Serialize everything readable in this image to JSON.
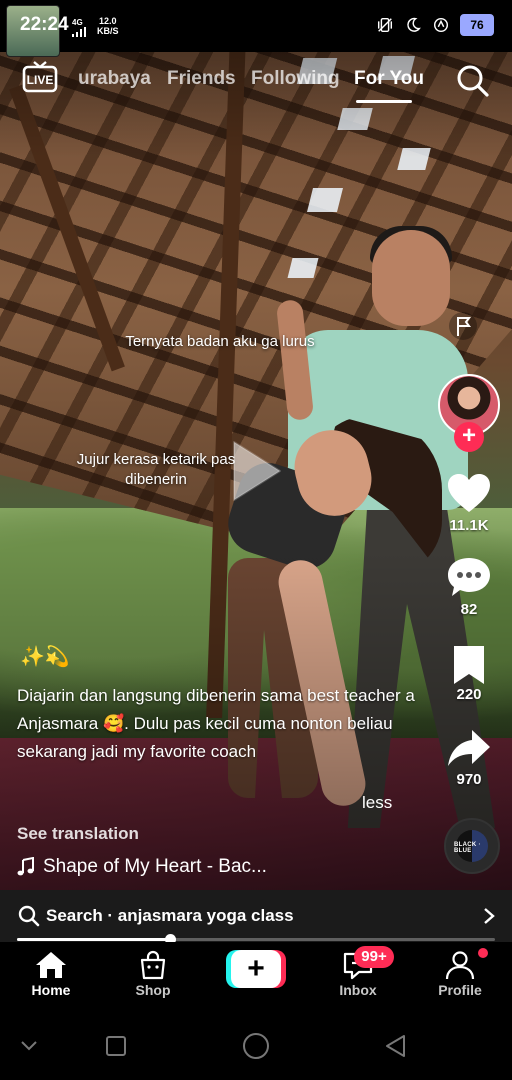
{
  "status_bar": {
    "time": "22:24",
    "network": "4G",
    "speed_value": "12.0",
    "speed_unit": "KB/S",
    "battery": "76"
  },
  "top_nav": {
    "live_label": "LIVE",
    "tabs": [
      "urabaya",
      "Friends",
      "Following",
      "For You"
    ],
    "active_tab": "For You"
  },
  "video": {
    "caption_overlay_1": "Ternyata badan aku ga lurus",
    "caption_overlay_2_line1": "Jujur kerasa ketarik pas",
    "caption_overlay_2_line2": "dibenerin"
  },
  "actions": {
    "likes": "11.1K",
    "comments": "82",
    "saves": "220",
    "shares": "970"
  },
  "post": {
    "emojis": "✨💫",
    "description_part1": "Diajarin dan langsung dibenerin sama best teacher a Anjasmara ",
    "description_emoji": "🥰",
    "description_part2": ". Dulu pas kecil cuma nonton beliau sekarang jadi my favorite coach",
    "less_label": "less",
    "see_translation": "See translation",
    "music": "Shape of My Heart - Bac...",
    "disc_label": "BLACK ∙ BLUE"
  },
  "search_bar": {
    "text": "Search · anjasmara yoga class"
  },
  "playback": {
    "progress": 0.32
  },
  "bottom_nav": {
    "items": [
      "Home",
      "Shop",
      "",
      "Inbox",
      "Profile"
    ],
    "inbox_badge": "99+",
    "active": "Home"
  },
  "colors": {
    "accent": "#fe2c55",
    "cyan": "#25f4ee",
    "battery": "#9aa8ff"
  }
}
